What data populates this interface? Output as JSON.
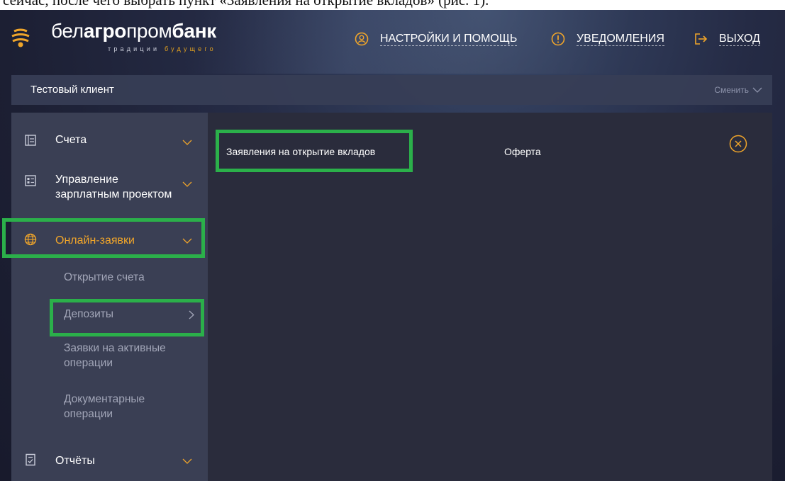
{
  "doc_text": "сейчас, после чего выбрать пункт «Заявления на открытие вкладов» (рис. 1).",
  "header": {
    "logo": {
      "name_light": "бел",
      "name_bold1": "агро",
      "name_light2": "пром",
      "name_bold2": "банк",
      "tagline_1": "традиции",
      "tagline_2": "будущего"
    },
    "nav": [
      {
        "label": "Настройки и помощь",
        "icon": "user-circle-icon"
      },
      {
        "label": "Уведомления",
        "icon": "alert-circle-icon"
      },
      {
        "label": "Выход",
        "icon": "logout-icon"
      }
    ]
  },
  "client_bar": {
    "name": "Тестовый клиент",
    "change_label": "Сменить"
  },
  "sidebar": {
    "items": [
      {
        "label": "Счета",
        "icon": "accounts-icon"
      },
      {
        "label": "Управление\nзарплатным проектом",
        "icon": "payroll-icon"
      },
      {
        "label": "Онлайн-заявки",
        "icon": "globe-icon",
        "active": true
      },
      {
        "label": "Отчёты",
        "icon": "report-icon"
      }
    ],
    "subitems": [
      {
        "label": "Открытие счета"
      },
      {
        "label": "Депозиты"
      },
      {
        "label": "Заявки на активные\nоперации"
      },
      {
        "label": "Документарные\nоперации"
      }
    ]
  },
  "main": {
    "tabs": [
      {
        "label": "Заявления на открытие вкладов"
      },
      {
        "label": "Оферта"
      }
    ]
  },
  "colors": {
    "accent": "#f0a52a",
    "highlight": "#2bb04a",
    "sidebar_bg": "#3a3f54",
    "main_bg": "#2a2c3c"
  }
}
